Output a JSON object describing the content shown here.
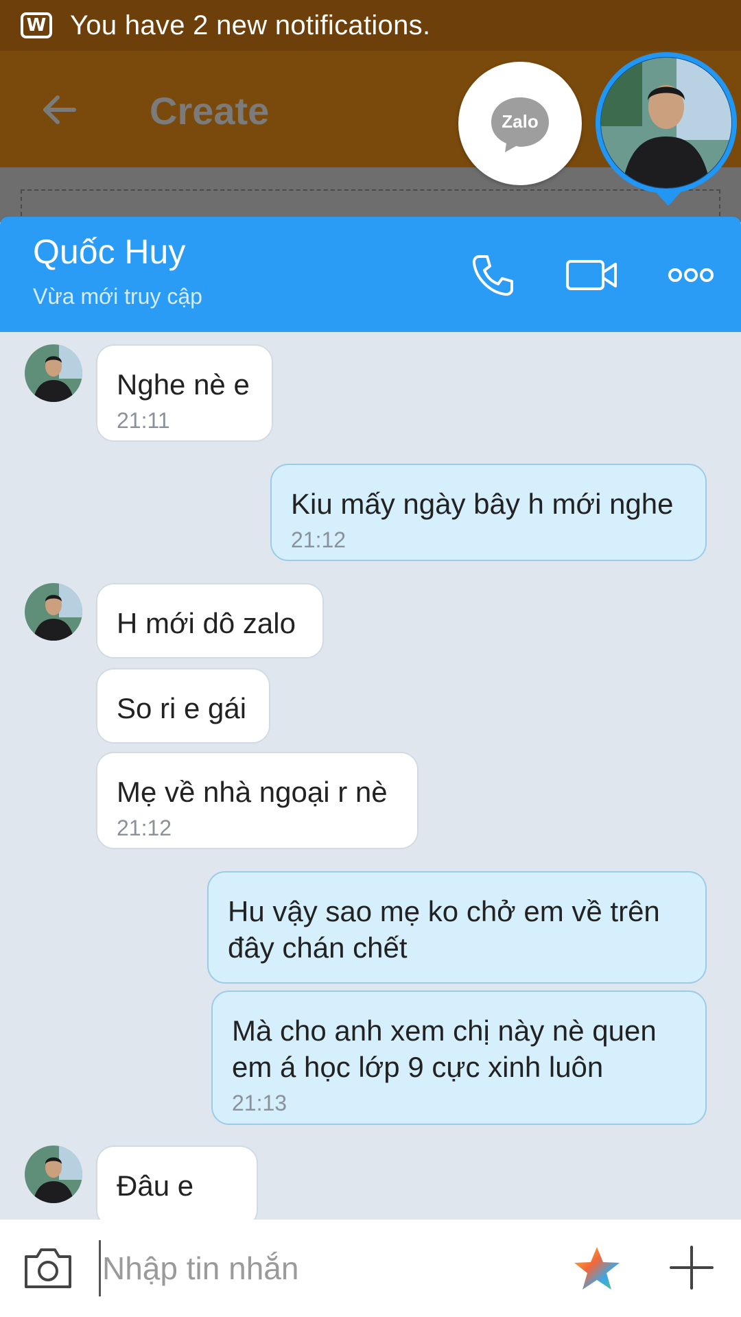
{
  "notification": {
    "text": "You have 2 new notifications.",
    "icon": "wattpad-w-icon"
  },
  "underlying_app": {
    "title": "Create",
    "back_icon": "arrow-left-icon"
  },
  "chat_heads": {
    "zalo_label": "Zalo",
    "accent": "#2196f3"
  },
  "chat": {
    "contact_name": "Quốc Huy",
    "contact_status": "Vừa mới truy cập",
    "header_color": "#2a9cf5",
    "actions": [
      "phone-icon",
      "video-camera-icon",
      "more-dots-icon"
    ]
  },
  "messages": [
    {
      "dir": "in",
      "lines": [
        "Nghe nè e"
      ],
      "time": "21:11",
      "avatar": true
    },
    {
      "dir": "out",
      "lines": [
        "Kiu mấy ngày bây h mới nghe"
      ],
      "time": "21:12"
    },
    {
      "dir": "in",
      "lines": [
        "H mới dô zalo"
      ],
      "time": "",
      "avatar": true
    },
    {
      "dir": "in",
      "lines": [
        "So ri e gái"
      ],
      "time": ""
    },
    {
      "dir": "in",
      "lines": [
        "Mẹ về nhà ngoại r nè"
      ],
      "time": "21:12"
    },
    {
      "dir": "out",
      "lines": [
        "Hu vậy sao mẹ ko chở em về trên",
        "đây chán chết"
      ],
      "time": ""
    },
    {
      "dir": "out",
      "lines": [
        "Mà cho anh xem chị này nè quen",
        "em á học lớp 9 cực xinh luôn"
      ],
      "time": "21:13"
    },
    {
      "dir": "in",
      "lines": [
        "Đâu e"
      ],
      "time": "",
      "avatar": true
    }
  ],
  "input": {
    "placeholder": "Nhập tin nhắn",
    "value": ""
  }
}
